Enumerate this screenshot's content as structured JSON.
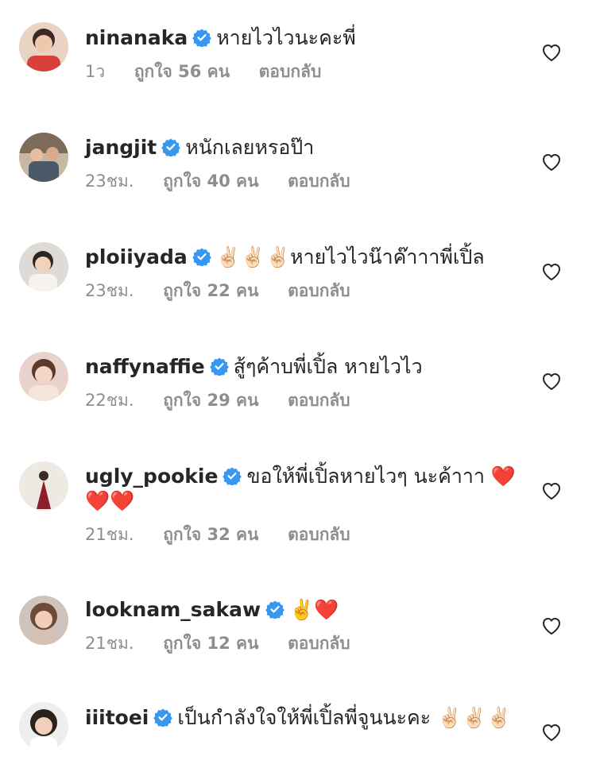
{
  "colors": {
    "verified": "#3897f0",
    "meta": "#8e8e8e",
    "text": "#262626",
    "emoji_heart": "#e0242b",
    "emoji_hand": "#f3d5b3"
  },
  "icons": {
    "verified": "verified-badge-icon",
    "like": "heart-outline-icon"
  },
  "comments": [
    {
      "username": "ninanaka",
      "text": "หายไวไวนะคะพี่",
      "time": "1ว",
      "likes": "ถูกใจ 56 คน",
      "reply": "ตอบกลับ"
    },
    {
      "username": "jangjit",
      "text": "หนักเลยหรอป๊า",
      "time": "23ชม.",
      "likes": "ถูกใจ 40 คน",
      "reply": "ตอบกลับ"
    },
    {
      "username": "ploiiyada",
      "text": "✌🏻✌🏻✌🏻หายไวไวน๊าค๊าาาพี่เปิ้ล",
      "time": "23ชม.",
      "likes": "ถูกใจ 22 คน",
      "reply": "ตอบกลับ"
    },
    {
      "username": "naffynaffie",
      "text": "สู้ๆค้าบพี่เปิ้ล หายไวไว",
      "time": "22ชม.",
      "likes": "ถูกใจ 29 คน",
      "reply": "ตอบกลับ"
    },
    {
      "username": "ugly_pookie",
      "text": "ขอให้พี่เปิ้ลหายไวๆ นะค้าาา ❤️❤️❤️",
      "time": "21ชม.",
      "likes": "ถูกใจ 32 คน",
      "reply": "ตอบกลับ"
    },
    {
      "username": "looknam_sakaw",
      "text": "✌️❤️",
      "time": "21ชม.",
      "likes": "ถูกใจ 12 คน",
      "reply": "ตอบกลับ"
    },
    {
      "username": "iiitoei",
      "text": "เป็นกำลังใจให้พี่เปิ้ลพี่จูนนะคะ ✌🏻✌🏻✌🏻",
      "time": "",
      "likes": "",
      "reply": ""
    }
  ]
}
